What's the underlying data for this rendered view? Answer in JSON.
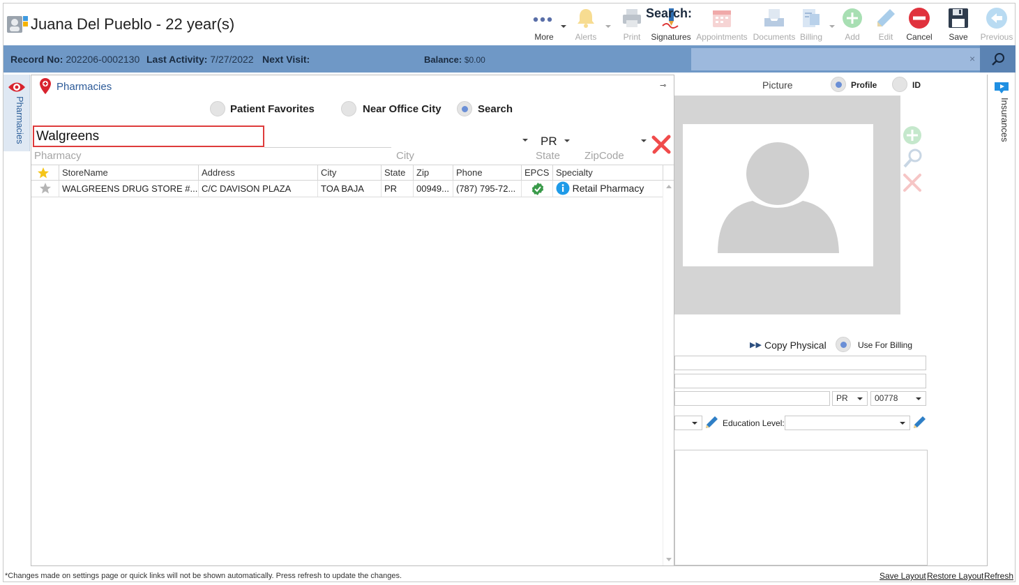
{
  "header": {
    "patient_title": "Juana Del Pueblo - 22 year(s)",
    "toolbar": [
      {
        "label": "More",
        "icon": "more-dots-icon",
        "enabled": true
      },
      {
        "label": "Alerts",
        "icon": "bell-icon",
        "enabled": false
      },
      {
        "label": "Print",
        "icon": "printer-icon",
        "enabled": false
      },
      {
        "label": "Signatures",
        "icon": "signature-pen-icon",
        "enabled": true
      },
      {
        "label": "Appointments",
        "icon": "calendar-icon",
        "enabled": false
      },
      {
        "label": "Documents",
        "icon": "documents-tray-icon",
        "enabled": false
      },
      {
        "label": "Billing",
        "icon": "billing-icon",
        "enabled": false
      },
      {
        "label": "Add",
        "icon": "plus-circle-icon",
        "enabled": false
      },
      {
        "label": "Edit",
        "icon": "pencil-icon",
        "enabled": false
      },
      {
        "label": "Cancel",
        "icon": "cancel-circle-icon",
        "enabled": true
      },
      {
        "label": "Save",
        "icon": "floppy-disk-icon",
        "enabled": true
      },
      {
        "label": "Previous",
        "icon": "arrow-left-circle-icon",
        "enabled": false
      }
    ]
  },
  "infobar": {
    "record_label": "Record No:",
    "record_value": "202206-0002130",
    "last_activity_label": "Last Activity:",
    "last_activity_value": "7/27/2022",
    "next_visit_label": "Next Visit:",
    "balance_label": "Balance:",
    "balance_value": "$0.00",
    "search_label": "Search:",
    "search_value": "",
    "clear_glyph": "×"
  },
  "left_strip": {
    "label": "Pharmacies"
  },
  "pharmacies": {
    "title": "Pharmacies",
    "pin_glyph": "⊸",
    "modes": [
      {
        "label": "Patient Favorites",
        "selected": false
      },
      {
        "label": "Near Office City",
        "selected": false
      },
      {
        "label": "Search",
        "selected": true
      }
    ],
    "pharmacy_value": "Walgreens",
    "pharmacy_caption": "Pharmacy",
    "city_caption": "City",
    "state_value": "PR",
    "state_caption": "State",
    "zip_caption": "ZipCode",
    "columns": [
      "StoreName",
      "Address",
      "City",
      "State",
      "Zip",
      "Phone",
      "EPCS",
      "Specialty"
    ],
    "rows": [
      {
        "favorite": false,
        "store": "WALGREENS DRUG STORE #...",
        "address": "C/C DAVISON PLAZA",
        "city": "TOA BAJA",
        "state": "PR",
        "zip": "00949...",
        "phone": "(787) 795-72...",
        "epcs": true,
        "specialty": "Retail Pharmacy"
      }
    ]
  },
  "right_panel": {
    "picture_label": "Picture",
    "profile_label": "Profile",
    "id_label": "ID",
    "picture_mode": "Profile",
    "copy_physical_label": "Copy Physical",
    "use_for_billing_label": "Use For Billing",
    "state_select": "PR",
    "zip_select": "00778",
    "education_label": "Education Level:",
    "education_value": ""
  },
  "right_strip": {
    "label": "Insurances"
  },
  "footer": {
    "note": "*Changes made on settings page or quick links will not be shown automatically. Press refresh to update the changes.",
    "links": [
      "Save Layout",
      "Restore Layout",
      "Refresh"
    ]
  },
  "colors": {
    "infobar": "#6f98c6",
    "search_box": "#9db9dd",
    "highlight_border": "#de3b3b",
    "link_blue": "#2c5a98",
    "cancel_red": "#e0323d"
  }
}
